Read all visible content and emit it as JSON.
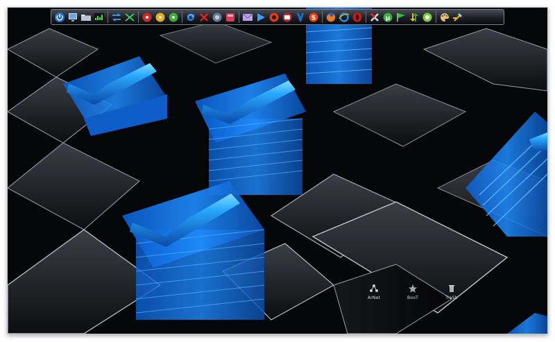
{
  "dock": {
    "icons": [
      {
        "name": "power-icon"
      },
      {
        "name": "computer-icon"
      },
      {
        "name": "folder-icon"
      },
      {
        "name": "system-monitor-icon"
      },
      {
        "name": "separator"
      },
      {
        "name": "connection-arrows-icon"
      },
      {
        "name": "disconnect-arrows-icon"
      },
      {
        "name": "separator"
      },
      {
        "name": "red-disc-icon"
      },
      {
        "name": "yellow-disc-icon"
      },
      {
        "name": "green-disc-icon"
      },
      {
        "name": "separator"
      },
      {
        "name": "refresh-icon"
      },
      {
        "name": "close-x-icon"
      },
      {
        "name": "globe-gear-icon"
      },
      {
        "name": "red-app-icon"
      },
      {
        "name": "separator"
      },
      {
        "name": "mail-icon"
      },
      {
        "name": "play-icon"
      },
      {
        "name": "media-player-icon"
      },
      {
        "name": "video-icon"
      },
      {
        "name": "instant-messenger-icon"
      },
      {
        "name": "skype-icon"
      },
      {
        "name": "separator"
      },
      {
        "name": "firefox-icon"
      },
      {
        "name": "internet-explorer-icon"
      },
      {
        "name": "opera-icon"
      },
      {
        "name": "separator"
      },
      {
        "name": "xchat-icon"
      },
      {
        "name": "utorrent-icon"
      },
      {
        "name": "green-flag-icon"
      },
      {
        "name": "download-arrows-icon"
      },
      {
        "name": "green-circle-app-icon"
      },
      {
        "name": "separator"
      },
      {
        "name": "paint-palette-icon"
      },
      {
        "name": "wrench-tool-icon"
      }
    ]
  },
  "desktop": {
    "icons": [
      {
        "label": "ArNet"
      },
      {
        "label": "BooT"
      },
      {
        "label": "TraSh"
      }
    ]
  },
  "colors": {
    "background": "#050608",
    "accent_blue": "#2aa8ff",
    "dock_bg": "#1c1f24"
  }
}
